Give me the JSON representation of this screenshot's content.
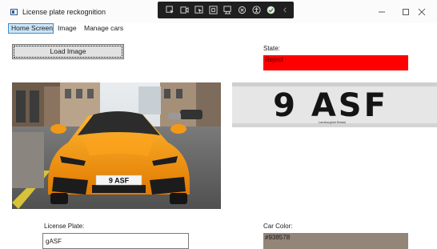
{
  "window": {
    "title": "License plate reckognition"
  },
  "debug_toolbar": {
    "icons": [
      "select-element-icon",
      "live-visual-tree-icon",
      "display-layout-icon",
      "track-focus-icon",
      "binding-failures-icon",
      "hot-reload-icon",
      "accessibility-icon",
      "check-icon",
      "collapse-icon"
    ]
  },
  "menu": {
    "items": [
      {
        "label": "Home Screen",
        "active": true
      },
      {
        "label": "Image",
        "active": false
      },
      {
        "label": "Manage cars",
        "active": false
      }
    ]
  },
  "main": {
    "load_button_label": "Load Image",
    "state_label": "State:",
    "state_value": "Reject",
    "state_color": "#ff0000",
    "license_plate_label": "License Plate:",
    "license_plate_value": "gASF",
    "car_color_label": "Car Color:",
    "car_color_value": "#938578",
    "plate_text": "9 ASF",
    "plate_dealer_text": "Lamborghini Bristol"
  }
}
